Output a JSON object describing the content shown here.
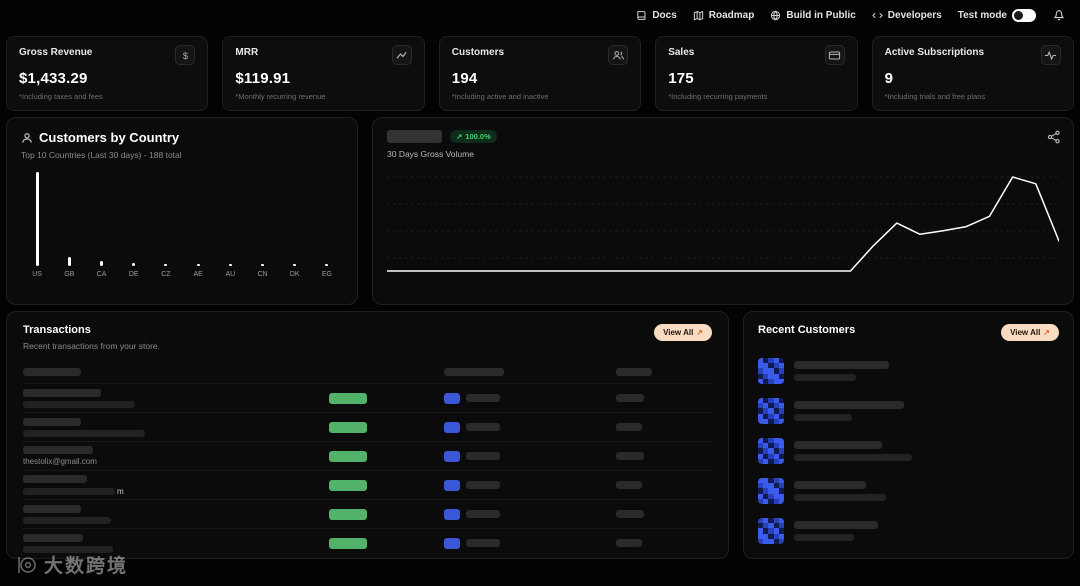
{
  "topbar": {
    "docs": "Docs",
    "roadmap": "Roadmap",
    "build_in_public": "Build in Public",
    "developers": "Developers",
    "test_mode": "Test mode"
  },
  "stats": [
    {
      "title": "Gross Revenue",
      "value": "$1,433.29",
      "note": "*Including taxes and fees",
      "icon": "dollar-icon"
    },
    {
      "title": "MRR",
      "value": "$119.91",
      "note": "*Monthly recurring revenue",
      "icon": "trending-up-icon"
    },
    {
      "title": "Customers",
      "value": "194",
      "note": "*Including active and inactive",
      "icon": "users-icon"
    },
    {
      "title": "Sales",
      "value": "175",
      "note": "*Including recurring payments",
      "icon": "credit-card-icon"
    },
    {
      "title": "Active Subscriptions",
      "value": "9",
      "note": "*Including trials and free plans",
      "icon": "activity-icon"
    }
  ],
  "country_card": {
    "title": "Customers by Country",
    "subtitle": "Top 10 Countries (Last 30 days) - 188 total"
  },
  "volume_card": {
    "badge_arrow": "↗",
    "badge_change": "100.0%",
    "subtitle": "30 Days Gross Volume"
  },
  "chart_data": [
    {
      "type": "bar",
      "title": "Customers by Country",
      "subtitle": "Top 10 Countries (Last 30 days) - 188 total",
      "categories": [
        "US",
        "GB",
        "CA",
        "DE",
        "CZ",
        "AE",
        "AU",
        "CN",
        "DK",
        "EG"
      ],
      "values": [
        151,
        14,
        8,
        5,
        3,
        2,
        2,
        1,
        1,
        1
      ],
      "total": 188,
      "bar_color": "#ffffff",
      "grid": false
    },
    {
      "type": "line",
      "title": "30 Days Gross Volume",
      "change_badge": "+100.0%",
      "x_range": [
        1,
        30
      ],
      "values": [
        0,
        0,
        0,
        0,
        0,
        0,
        0,
        0,
        0,
        0,
        0,
        0,
        0,
        0,
        0,
        0,
        0,
        0,
        0,
        0,
        0,
        300,
        560,
        430,
        470,
        520,
        640,
        1100,
        1020,
        350
      ],
      "ylim": [
        0,
        1100
      ],
      "line_color": "#ffffff",
      "grid": "dashed-horizontal",
      "legend": "none"
    }
  ],
  "transactions": {
    "title": "Transactions",
    "subtitle": "Recent transactions from your store.",
    "view_all_label": "View All",
    "view_all_arrow": "↗",
    "header_blocks": {
      "c1": 58,
      "c3": 60,
      "c4": 36
    },
    "rows": [
      {
        "l1": 78,
        "l2": 112,
        "amt": 38,
        "pg": 34,
        "r": 28
      },
      {
        "l1": 58,
        "l2": 122,
        "amt": 38,
        "pg": 34,
        "r": 26
      },
      {
        "l1": 70,
        "email": "thestolix@gmail.com",
        "amt": 38,
        "pg": 34,
        "r": 28
      },
      {
        "l1": 64,
        "l2": 92,
        "l2_suffix": "m",
        "amt": 38,
        "pg": 34,
        "r": 26
      },
      {
        "l1": 58,
        "l2": 88,
        "amt": 38,
        "pg": 34,
        "r": 28
      },
      {
        "l1": 60,
        "l2": 90,
        "amt": 38,
        "pg": 34,
        "r": 26
      }
    ],
    "amount_color": "#53b26a",
    "product_color": "#3a57d7"
  },
  "recent_customers": {
    "title": "Recent Customers",
    "view_all_label": "View All",
    "view_all_arrow": "↗",
    "rows": [
      {
        "lines": [
          95,
          62
        ]
      },
      {
        "lines": [
          110,
          58
        ]
      },
      {
        "lines": [
          88,
          118
        ]
      },
      {
        "lines": [
          72,
          92
        ]
      },
      {
        "lines": [
          84,
          60
        ]
      },
      {
        "lines": [
          68,
          88
        ]
      }
    ],
    "avatar_colors": [
      "#3b5bec",
      "#2741b8",
      "#101c4e"
    ]
  },
  "watermark": "大数跨境",
  "colors": {
    "badge_bg": "#0e2c1b",
    "badge_text": "#45d06e",
    "view_all_bg": "#f8dcc2",
    "view_all_arrow": "#e0622a"
  }
}
